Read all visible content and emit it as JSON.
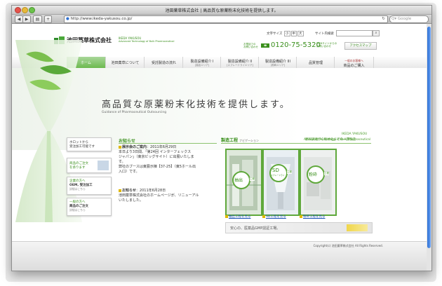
{
  "window": {
    "title": "池田薬草株式会社 | 高品質な原薬粉末化技術を提供します。",
    "url": "http://www.ikeda-yakusou.co.jp/",
    "search_placeholder": "Google",
    "back": "◀",
    "forward": "▶",
    "add": "+",
    "reload": "↻"
  },
  "header": {
    "logo_text": "池田薬草株式会社",
    "logo_sub1": "IKEDA YAKUSOU",
    "logo_sub2": "Advanced Technology of Bulk Pharmaceutical",
    "font_size_label": "文字サイズ",
    "font_sizes": [
      "小",
      "中",
      "大"
    ],
    "site_search_label": "サイト内検索",
    "phone_label": "お電話での\nお問い合わせ",
    "free_dial": "0120-75-5320",
    "web_inquiry": "WEBサイトからの\nお問い合わせ",
    "access_map": "アクセスマップ"
  },
  "nav": [
    {
      "l1": "ホーム",
      "l2": ""
    },
    {
      "l1": "池田薬草について",
      "l2": ""
    },
    {
      "l1": "受託製造の流れ",
      "l2": ""
    },
    {
      "l1": "製造設備紹介 I",
      "l2": "[抽出エリア]"
    },
    {
      "l1": "製造設備紹介 II",
      "l2": "[スプレードライエリア]"
    },
    {
      "l1": "製造設備紹介 III",
      "l2": "[粉砕エリア]"
    },
    {
      "l1": "品質管理",
      "l2": ""
    },
    {
      "l1": "一般のお客様へ",
      "l2": "商品のご購入"
    }
  ],
  "hero": {
    "tagline": "高品質な原薬粉末化技術を提供します。",
    "subtitle": "Guidance of Pharmaceutical Outsourcing",
    "brand": "IKEDA YAKUSOU",
    "brand_sub": "Advanced Technology of Bulk Pharmaceutical"
  },
  "side_buttons": [
    {
      "l1": "ホロットから",
      "l2": "受注加工可能です"
    },
    {
      "l1": "商品のご注文",
      "l2": "を承ります"
    },
    {
      "l1": "企業の方へ",
      "l2": "OEM, 受注加工",
      "l3": "詳細はこちら"
    },
    {
      "l1": "一般の方へ",
      "l2": "商品のご注文",
      "l3": "詳細はこちら"
    }
  ],
  "news": {
    "title": "お知らせ",
    "items": [
      {
        "head": "展示会のご案内",
        "date": "：2011年6月29日",
        "body": [
          "本日より3日間、「第24回 インターフェックス",
          "ジャパン」（東京ビッグサイト）に出展いたしま",
          "す。",
          "弊社のブースは東展示棟【37-25】（東5ホール出",
          "入口）です。"
        ]
      },
      {
        "head": "お知らせ",
        "date": "：2011年6月28日",
        "body": [
          "池田薬草株式会社のホームページが、リニューアル",
          "いたしました。"
        ]
      }
    ]
  },
  "process": {
    "title": "製造工程",
    "title_sub": "ナビゲーション",
    "note": "原料調達から粉体化までの一貫製造",
    "cards": [
      {
        "badge": "抽出",
        "suffix": "工程",
        "link": "抽出工程を見る"
      },
      {
        "badge": "SD",
        "suffix": "工程",
        "sub": "スプレードライ",
        "link": "SD工程を見る"
      },
      {
        "badge": "粉砕",
        "suffix": "工程",
        "link": "粉砕工程を見る"
      }
    ],
    "gmp": "安心の、医薬品GMP認証工場。"
  },
  "footer": {
    "copyright": "Copyright(c) 池田薬草株式会社 All Rights Reserved."
  },
  "colors": {
    "brand_green": "#3a8f1c",
    "accent_yellow": "#e0b800"
  }
}
